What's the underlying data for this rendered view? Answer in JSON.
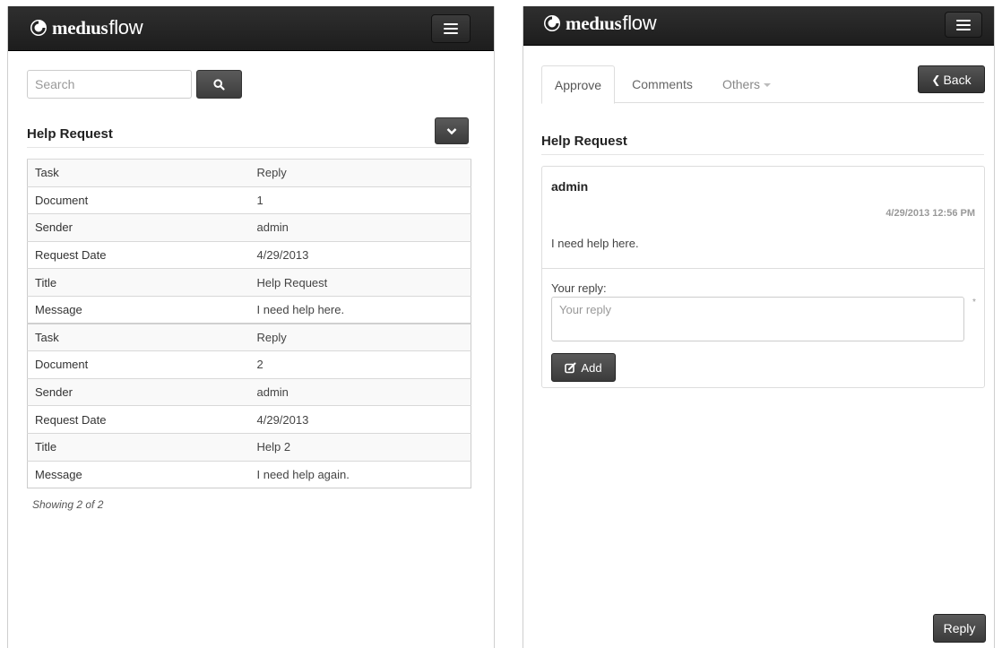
{
  "app": {
    "brand_bold": "medıus",
    "brand_light": "flow"
  },
  "colors": {
    "navbar": "#222222",
    "button": "#444444",
    "text": "#333333",
    "border": "#dddddd"
  },
  "left": {
    "search": {
      "placeholder": "Search",
      "value": "",
      "button_icon": "search-icon"
    },
    "section_title": "Help Request",
    "collapse_icon": "chevron-down-icon",
    "records": [
      {
        "rows": [
          {
            "key": "Task",
            "value": "Reply"
          },
          {
            "key": "Document",
            "value": "1"
          },
          {
            "key": "Sender",
            "value": "admin"
          },
          {
            "key": "Request Date",
            "value": "4/29/2013"
          },
          {
            "key": "Title",
            "value": "Help Request"
          },
          {
            "key": "Message",
            "value": "I need help here."
          }
        ]
      },
      {
        "rows": [
          {
            "key": "Task",
            "value": "Reply"
          },
          {
            "key": "Document",
            "value": "2"
          },
          {
            "key": "Sender",
            "value": "admin"
          },
          {
            "key": "Request Date",
            "value": "4/29/2013"
          },
          {
            "key": "Title",
            "value": "Help 2"
          },
          {
            "key": "Message",
            "value": "I need help again."
          }
        ]
      }
    ],
    "showing": "Showing 2 of 2"
  },
  "right": {
    "tabs": [
      {
        "label": "Approve",
        "active": true
      },
      {
        "label": "Comments",
        "active": false
      },
      {
        "label": "Others",
        "active": false
      }
    ],
    "back_label": "Back",
    "section_title": "Help Request",
    "comment": {
      "author": "admin",
      "date": "4/29/2013 12:56 PM",
      "body": "I need help here."
    },
    "reply_label": "Your reply:",
    "reply_placeholder": "Your reply",
    "required_mark": "*",
    "add_label": "Add",
    "reply_button_label": "Reply"
  }
}
